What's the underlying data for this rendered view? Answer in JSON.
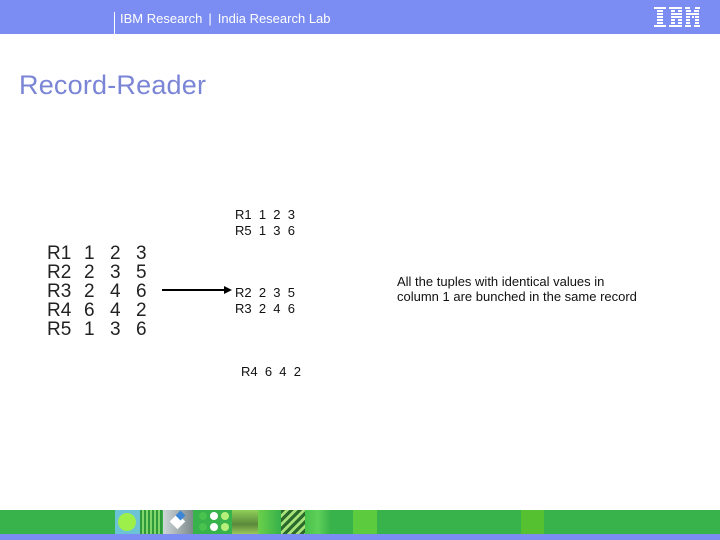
{
  "header": {
    "org": "IBM Research",
    "separator": "|",
    "lab": "India Research Lab",
    "logo": "IBM",
    "background_color": "#7b8df2"
  },
  "page_title": "Record-Reader",
  "input_table": {
    "rows": [
      {
        "id": "R1",
        "values": [
          "1",
          "2",
          "3"
        ]
      },
      {
        "id": "R2",
        "values": [
          "2",
          "3",
          "5"
        ]
      },
      {
        "id": "R3",
        "values": [
          "2",
          "4",
          "6"
        ]
      },
      {
        "id": "R4",
        "values": [
          "6",
          "4",
          "2"
        ]
      },
      {
        "id": "R5",
        "values": [
          "1",
          "3",
          "6"
        ]
      }
    ]
  },
  "arrow_icon": "right-arrow",
  "output_records": [
    {
      "rows": [
        "R1  1  2  3",
        "R5  1  3  6"
      ]
    },
    {
      "rows": [
        "R2  2  3  5",
        "R3  2  4  6"
      ]
    },
    {
      "rows": [
        "R4  6  4  2"
      ]
    }
  ],
  "note": {
    "line1": "All the tuples with identical values in",
    "line2": "column 1 are bunched in the same record"
  },
  "footer": {
    "main_color": "#38b24a",
    "bottom_color": "#7b8df2"
  }
}
